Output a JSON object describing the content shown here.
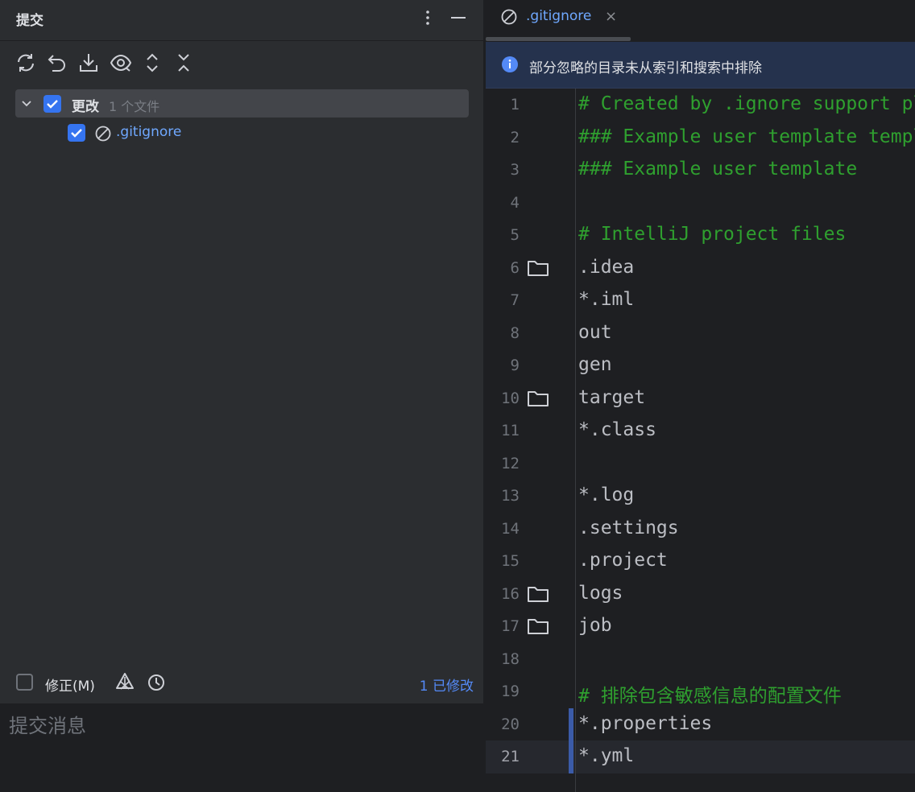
{
  "commit_panel": {
    "title": "提交",
    "toolbar": [
      "refresh-icon",
      "rollback-icon",
      "shelve-icon",
      "preview-icon",
      "expand-all-icon",
      "collapse-all-icon"
    ],
    "changes_group": {
      "label": "更改",
      "count": "1 个文件",
      "checked": true
    },
    "files": [
      {
        "name": ".gitignore",
        "checked": true,
        "icon": "ignored-file-icon"
      }
    ],
    "amend_label": "修正(M)",
    "modified_link": "1 已修改",
    "commit_message_placeholder": "提交消息"
  },
  "editor": {
    "tab": {
      "label": ".gitignore",
      "close": "×"
    },
    "banner": {
      "text": "部分忽略的目录未从索引和搜索中排除"
    },
    "current_line": 21,
    "lines": [
      {
        "n": "1",
        "text": "# Created by .ignore support plugin (hsz.mobi)",
        "comment": true
      },
      {
        "n": "2",
        "text": "### Example user template template",
        "comment": true
      },
      {
        "n": "3",
        "text": "### Example user template",
        "comment": true
      },
      {
        "n": "4",
        "text": ""
      },
      {
        "n": "5",
        "text": "# IntelliJ project files",
        "comment": true
      },
      {
        "n": "6",
        "text": ".idea",
        "folder": true
      },
      {
        "n": "7",
        "text": "*.iml"
      },
      {
        "n": "8",
        "text": "out"
      },
      {
        "n": "9",
        "text": "gen"
      },
      {
        "n": "10",
        "text": "target",
        "folder": true
      },
      {
        "n": "11",
        "text": "*.class"
      },
      {
        "n": "12",
        "text": ""
      },
      {
        "n": "13",
        "text": "*.log"
      },
      {
        "n": "14",
        "text": ".settings"
      },
      {
        "n": "15",
        "text": ".project"
      },
      {
        "n": "16",
        "text": "logs",
        "folder": true
      },
      {
        "n": "17",
        "text": "job",
        "folder": true
      },
      {
        "n": "18",
        "text": ""
      },
      {
        "n": "19",
        "text": "# 排除包含敏感信息的配置文件",
        "comment": true
      },
      {
        "n": "20",
        "text": "*.properties",
        "changed": true
      },
      {
        "n": "21",
        "text": "*.yml",
        "changed": true
      }
    ]
  },
  "colors": {
    "accent": "#3574f0",
    "link": "#548af7",
    "comment": "#2fa02f",
    "banner_bg": "#25324d"
  }
}
